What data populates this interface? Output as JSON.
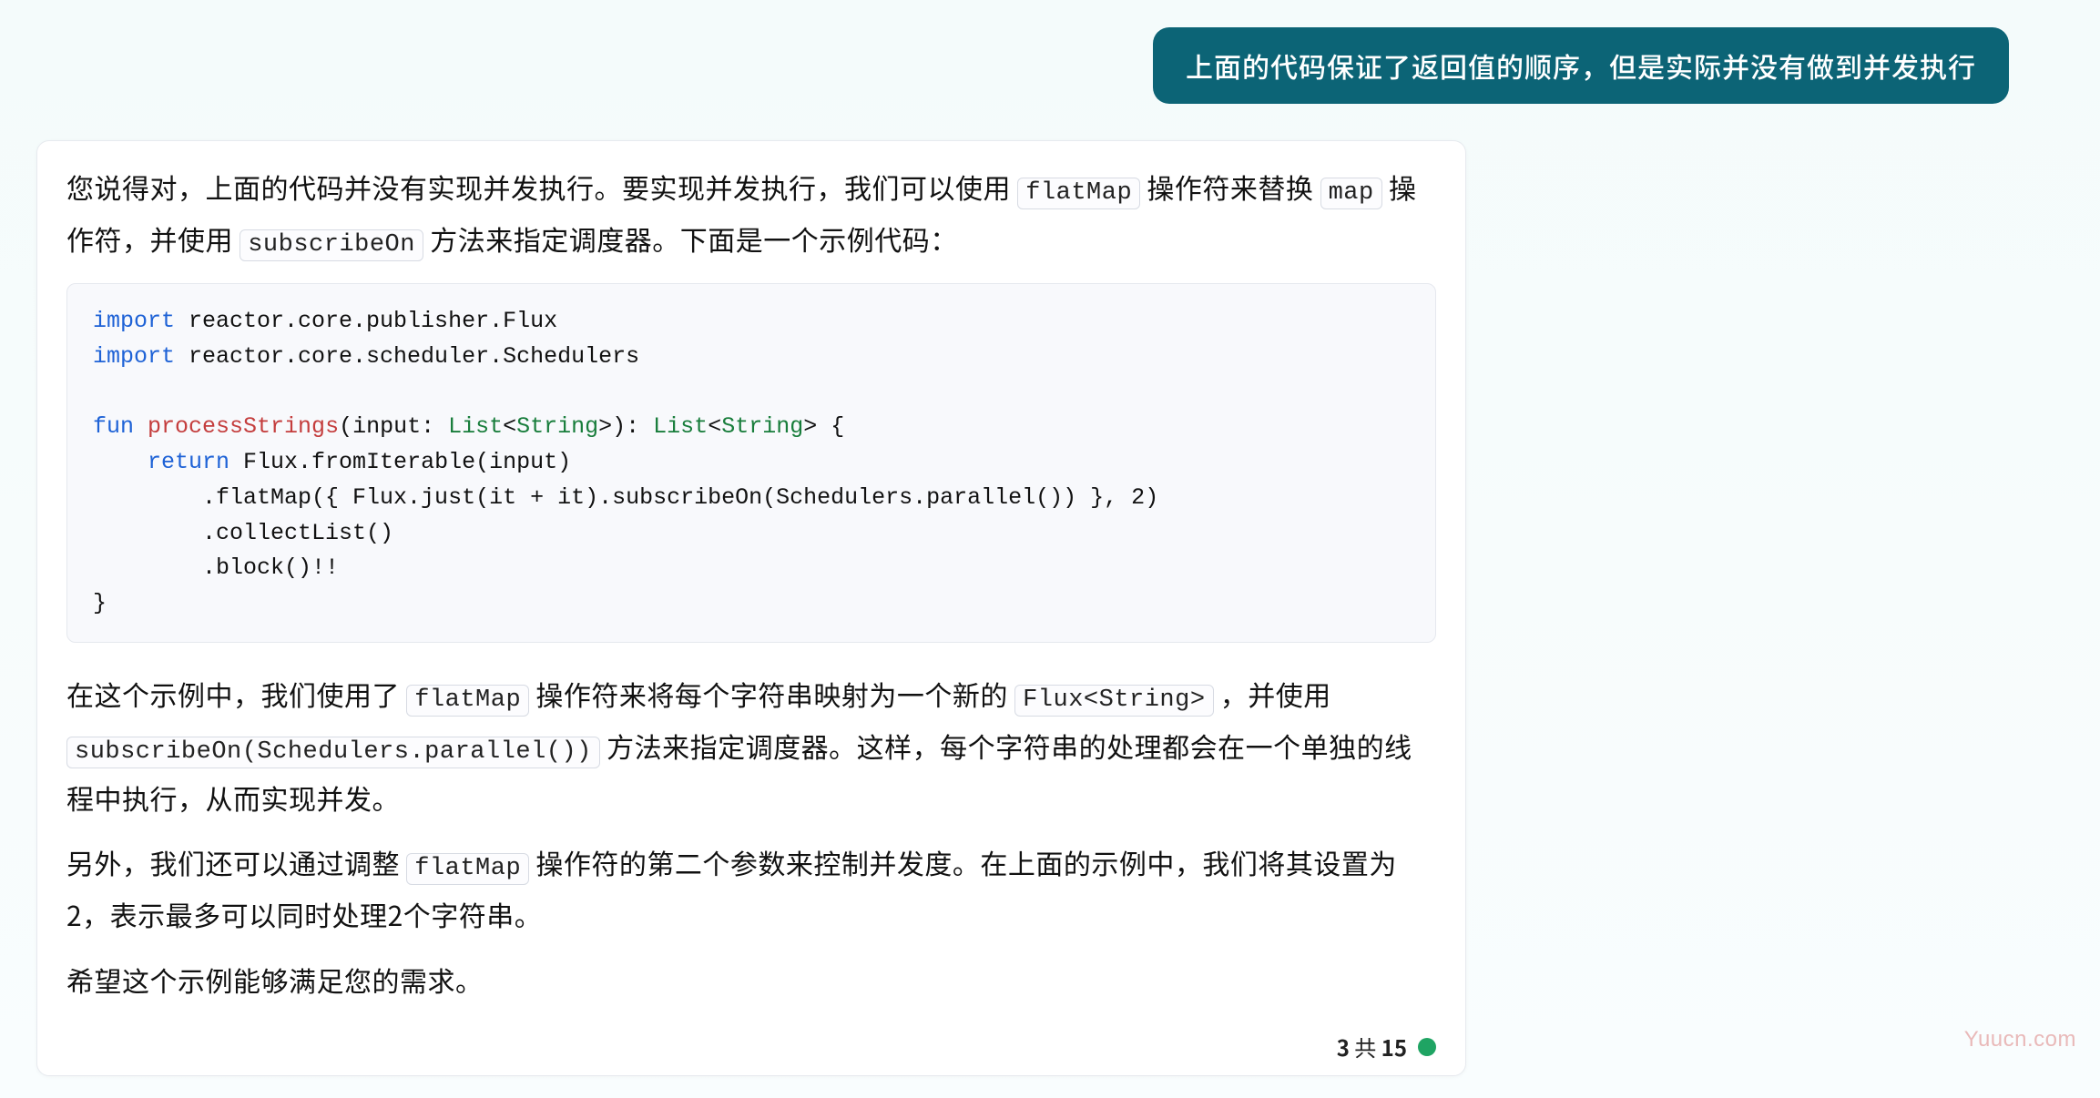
{
  "user_message": "上面的代码保证了返回值的顺序，但是实际并没有做到并发执行",
  "assistant": {
    "p1": {
      "t1": "您说得对，上面的代码并没有实现并发执行。要实现并发执行，我们可以使用 ",
      "c1": "flatMap",
      "t2": " 操作符来替换 ",
      "c2": "map",
      "t3": " 操作符，并使用 ",
      "c3": "subscribeOn",
      "t4": " 方法来指定调度器。下面是一个示例代码："
    },
    "code": {
      "l1_a": "import",
      "l1_b": " reactor.core.publisher.Flux",
      "l2_a": "import",
      "l2_b": " reactor.core.scheduler.Schedulers",
      "blank1": "",
      "l3_a": "fun",
      "l3_b": " ",
      "l3_c": "processStrings",
      "l3_d": "(input: ",
      "l3_e": "List",
      "l3_f": "<",
      "l3_g": "String",
      "l3_h": ">): ",
      "l3_i": "List",
      "l3_j": "<",
      "l3_k": "String",
      "l3_l": "> {",
      "l4_a": "    ",
      "l4_b": "return",
      "l4_c": " Flux.fromIterable(input)",
      "l5": "        .flatMap({ Flux.just(it + it).subscribeOn(Schedulers.parallel()) }, 2)",
      "l6": "        .collectList()",
      "l7": "        .block()!!",
      "l8": "}"
    },
    "p2": {
      "t1": "在这个示例中，我们使用了 ",
      "c1": "flatMap",
      "t2": " 操作符来将每个字符串映射为一个新的 ",
      "c2": "Flux<String>",
      "t3": " ，并使用 ",
      "c3": "subscribeOn(Schedulers.parallel())",
      "t4": " 方法来指定调度器。这样，每个字符串的处理都会在一个单独的线程中执行，从而实现并发。"
    },
    "p3": {
      "t1": "另外，我们还可以通过调整 ",
      "c1": "flatMap",
      "t2": " 操作符的第二个参数来控制并发度。在上面的示例中，我们将其设置为2，表示最多可以同时处理2个字符串。"
    },
    "p4": "希望这个示例能够满足您的需求。"
  },
  "status": {
    "current": "3",
    "sep": " 共 ",
    "total": "15"
  },
  "watermark": "Yuucn.com"
}
